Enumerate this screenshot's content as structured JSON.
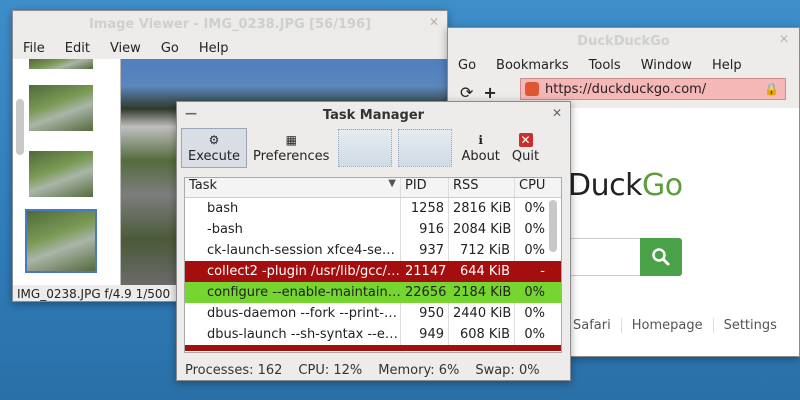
{
  "viewer": {
    "title": "Image Viewer - IMG_0238.JPG [56/196]",
    "menu": [
      "File",
      "Edit",
      "View",
      "Go",
      "Help"
    ],
    "status": "IMG_0238.JPG  f/4.9 1/500"
  },
  "browser": {
    "title": "DuckDuckGo",
    "menu": [
      "Go",
      "Bookmarks",
      "Tools",
      "Window",
      "Help"
    ],
    "url": "https://duckduckgo.com/",
    "logo_text": "Duck",
    "logo_accent": "Go",
    "links": [
      "Safari",
      "Homepage",
      "Settings"
    ]
  },
  "taskmgr": {
    "title": "Task Manager",
    "toolbar": {
      "execute": "Execute",
      "preferences": "Preferences",
      "about": "About",
      "quit": "Quit"
    },
    "columns": [
      "Task",
      "PID",
      "RSS",
      "CPU"
    ],
    "rows": [
      {
        "task": "bash",
        "pid": "1258",
        "rss": "2816 KiB",
        "cpu": "0%"
      },
      {
        "task": "-bash",
        "pid": "916",
        "rss": "2084 KiB",
        "cpu": "0%"
      },
      {
        "task": "ck-launch-session xfce4-se…",
        "pid": "937",
        "rss": "712 KiB",
        "cpu": "0%"
      },
      {
        "task": "collect2 -plugin /usr/lib/gcc/…",
        "pid": "21147",
        "rss": "644 KiB",
        "cpu": "-"
      },
      {
        "task": "configure --enable-maintain…",
        "pid": "22656",
        "rss": "2184 KiB",
        "cpu": "0%"
      },
      {
        "task": "dbus-daemon --fork --print-…",
        "pid": "950",
        "rss": "2440 KiB",
        "cpu": "0%"
      },
      {
        "task": "dbus-launch --sh-syntax --e…",
        "pid": "949",
        "rss": "608 KiB",
        "cpu": "0%"
      }
    ],
    "status": {
      "processes": "Processes: 162",
      "cpu": "CPU: 12%",
      "memory": "Memory: 6%",
      "swap": "Swap: 0%"
    }
  }
}
